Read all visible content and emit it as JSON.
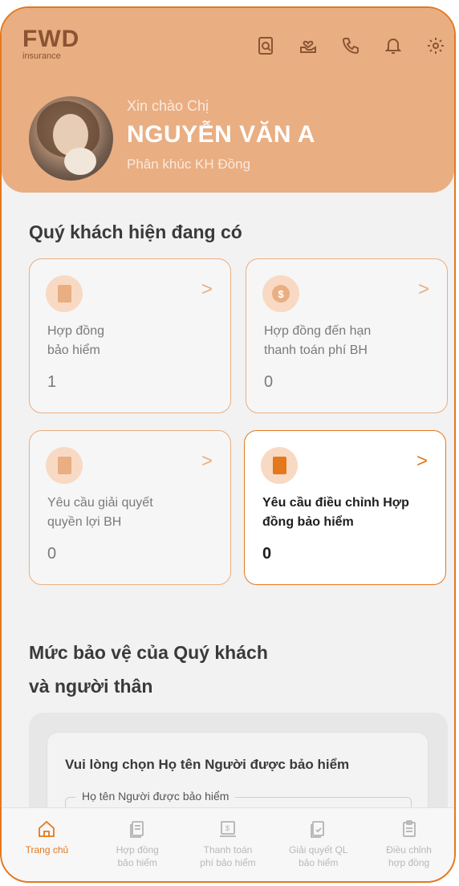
{
  "brand": {
    "name": "FWD",
    "tagline": "insurance"
  },
  "header_icons": [
    "document-search-icon",
    "hand-heart-icon",
    "phone-icon",
    "bell-icon",
    "gear-icon"
  ],
  "greeting": {
    "hello": "Xin chào Chị",
    "name": "NGUYỄN VĂN A",
    "segment": "Phân khúc KH Đồng"
  },
  "summary": {
    "title": "Quý khách hiện đang có",
    "cards": [
      {
        "label": "Hợp đồng\nbảo hiểm",
        "count": "1",
        "icon": "contract-icon"
      },
      {
        "label": "Hợp đồng đến hạn\nthanh toán phí BH",
        "count": "0",
        "icon": "dollar-coin-icon"
      },
      {
        "label": "Yêu cầu giải quyết\nquyền lợi BH",
        "count": "0",
        "icon": "claim-doc-icon"
      },
      {
        "label": "Yêu cầu điều chỉnh Hợp\nđồng bảo hiểm",
        "count": "0",
        "icon": "edit-doc-icon"
      }
    ]
  },
  "protection": {
    "title_line1": "Mức bảo vệ của Quý khách",
    "title_line2": "và người thân",
    "prompt": "Vui lòng chọn Họ tên Người được bảo hiểm",
    "field_label": "Họ tên Người được bảo hiểm"
  },
  "bottom_nav": [
    {
      "label": "Trang chủ",
      "icon": "home-icon",
      "active": true
    },
    {
      "label": "Hợp đồng\nbảo hiểm",
      "icon": "contracts-icon",
      "active": false
    },
    {
      "label": "Thanh toán\nphí bảo hiểm",
      "icon": "payment-icon",
      "active": false
    },
    {
      "label": "Giải quyết QL\nbảo hiểm",
      "icon": "claims-icon",
      "active": false
    },
    {
      "label": "Điều chỉnh\nhợp đồng",
      "icon": "adjust-contract-icon",
      "active": false
    }
  ],
  "colors": {
    "accent": "#e4781d",
    "header": "#e9ae82"
  }
}
